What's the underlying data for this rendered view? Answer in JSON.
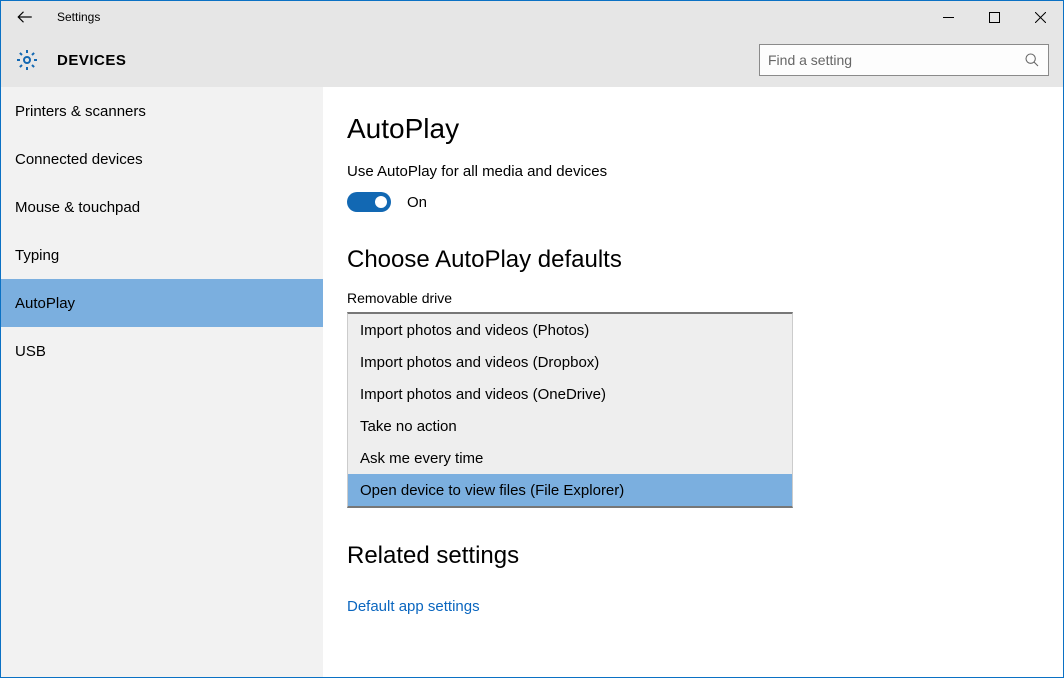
{
  "window": {
    "title": "Settings"
  },
  "header": {
    "category": "DEVICES",
    "search_placeholder": "Find a setting"
  },
  "sidebar": {
    "items": [
      {
        "label": "Printers & scanners",
        "active": false
      },
      {
        "label": "Connected devices",
        "active": false
      },
      {
        "label": "Mouse & touchpad",
        "active": false
      },
      {
        "label": "Typing",
        "active": false
      },
      {
        "label": "AutoPlay",
        "active": true
      },
      {
        "label": "USB",
        "active": false
      }
    ]
  },
  "main": {
    "page_title": "AutoPlay",
    "autoplay_label": "Use AutoPlay for all media and devices",
    "toggle_state": "On",
    "section_title": "Choose AutoPlay defaults",
    "field_label": "Removable drive",
    "dropdown": {
      "options": [
        {
          "label": "Import photos and videos (Photos)",
          "selected": false
        },
        {
          "label": "Import photos and videos (Dropbox)",
          "selected": false
        },
        {
          "label": "Import photos and videos (OneDrive)",
          "selected": false
        },
        {
          "label": "Take no action",
          "selected": false
        },
        {
          "label": "Ask me every time",
          "selected": false
        },
        {
          "label": "Open device to view files (File Explorer)",
          "selected": true
        }
      ]
    },
    "related_title": "Related settings",
    "related_link": "Default app settings"
  }
}
